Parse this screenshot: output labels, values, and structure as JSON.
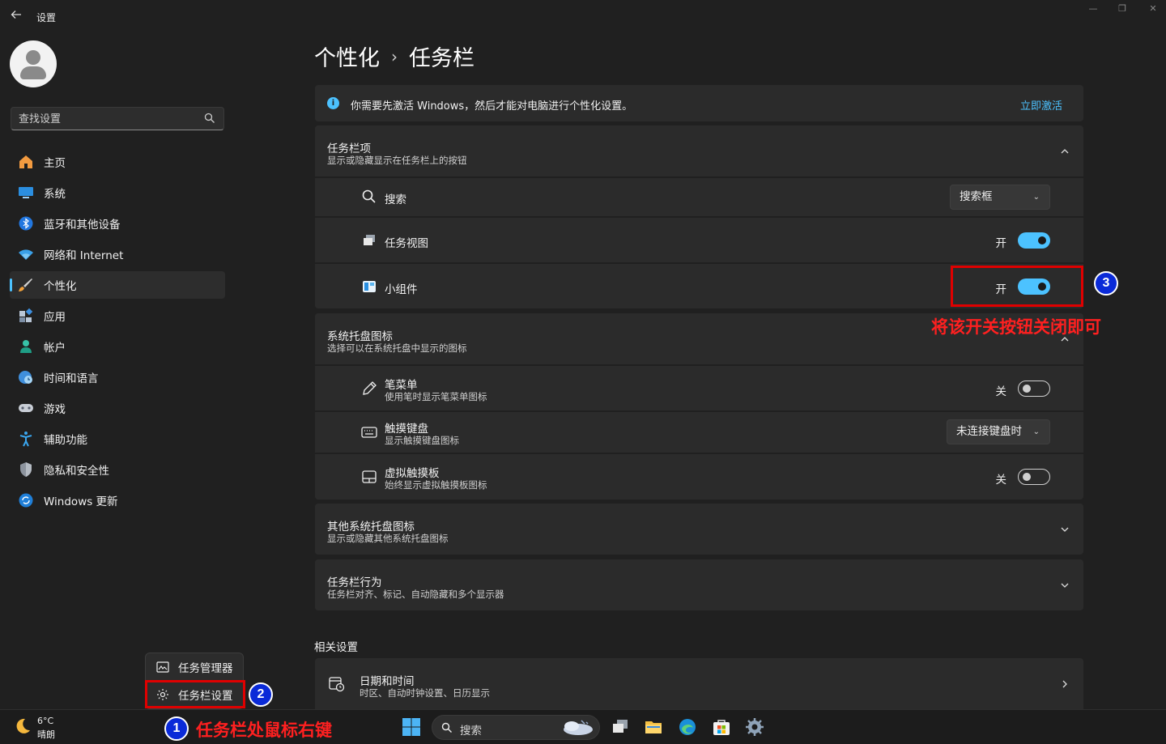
{
  "window": {
    "title": "设置",
    "back_icon": "arrow-left-icon",
    "minimize_glyph": "—",
    "maximize_glyph": "❐",
    "close_glyph": "✕"
  },
  "sidebar": {
    "search_placeholder": "查找设置",
    "items": [
      {
        "label": "主页",
        "icon": "home-icon"
      },
      {
        "label": "系统",
        "icon": "monitor-icon"
      },
      {
        "label": "蓝牙和其他设备",
        "icon": "bluetooth-icon"
      },
      {
        "label": "网络和 Internet",
        "icon": "wifi-icon"
      },
      {
        "label": "个性化",
        "icon": "brush-icon",
        "active": true
      },
      {
        "label": "应用",
        "icon": "apps-icon"
      },
      {
        "label": "帐户",
        "icon": "account-icon"
      },
      {
        "label": "时间和语言",
        "icon": "globe-clock-icon"
      },
      {
        "label": "游戏",
        "icon": "gamepad-icon"
      },
      {
        "label": "辅助功能",
        "icon": "accessibility-icon"
      },
      {
        "label": "隐私和安全性",
        "icon": "shield-icon"
      },
      {
        "label": "Windows 更新",
        "icon": "update-icon"
      }
    ]
  },
  "breadcrumb": {
    "parent": "个性化",
    "separator": "›",
    "current": "任务栏"
  },
  "activation": {
    "message": "你需要先激活 Windows，然后才能对电脑进行个性化设置。",
    "link": "立即激活"
  },
  "taskbar_items": {
    "title": "任务栏项",
    "subtitle": "显示或隐藏显示在任务栏上的按钮",
    "rows": [
      {
        "label": "搜索",
        "icon": "search-icon",
        "dropdown": "搜索框"
      },
      {
        "label": "任务视图",
        "icon": "task-view-icon",
        "state": "开",
        "toggle_on": true
      },
      {
        "label": "小组件",
        "icon": "widgets-icon",
        "state": "开",
        "toggle_on": true
      }
    ]
  },
  "tray_icons": {
    "title": "系统托盘图标",
    "subtitle": "选择可以在系统托盘中显示的图标",
    "rows": [
      {
        "label": "笔菜单",
        "desc": "使用笔时显示笔菜单图标",
        "icon": "pen-icon",
        "state": "关",
        "toggle_on": false
      },
      {
        "label": "触摸键盘",
        "desc": "显示触摸键盘图标",
        "icon": "keyboard-icon",
        "dropdown": "未连接键盘时"
      },
      {
        "label": "虚拟触摸板",
        "desc": "始终显示虚拟触摸板图标",
        "icon": "touchpad-icon",
        "state": "关",
        "toggle_on": false
      }
    ]
  },
  "other_tray": {
    "title": "其他系统托盘图标",
    "subtitle": "显示或隐藏其他系统托盘图标"
  },
  "behaviors": {
    "title": "任务栏行为",
    "subtitle": "任务栏对齐、标记、自动隐藏和多个显示器"
  },
  "related": {
    "heading": "相关设置",
    "item_title": "日期和时间",
    "item_desc": "时区、自动时钟设置、日历显示"
  },
  "context_menu": {
    "items": [
      {
        "label": "任务管理器",
        "icon": "task-manager-icon"
      },
      {
        "label": "任务栏设置",
        "icon": "gear-icon"
      }
    ]
  },
  "annotations": {
    "badge1": "1",
    "badge2": "2",
    "badge3": "3",
    "note_bottom": "任务栏处鼠标右键",
    "note_right": "将该开关按钮关闭即可"
  },
  "taskbar": {
    "temperature": "6°C",
    "condition": "晴朗",
    "search_label": "搜索"
  },
  "colors": {
    "accent": "#4cc2ff",
    "background": "#202020",
    "card": "#2b2b2b",
    "annotation_red": "#e00000",
    "badge_blue": "#0a2ad8"
  }
}
